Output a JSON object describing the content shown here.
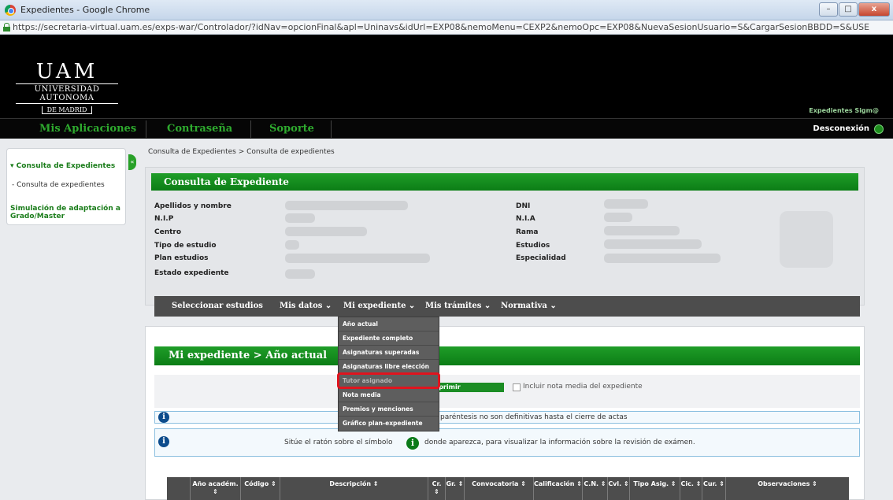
{
  "browser": {
    "window_title": "Expedientes - Google Chrome",
    "url": "https://secretaria-virtual.uam.es/exps-war/Controlador/?idNav=opcionFinal&apl=Uninavs&idUrl=EXP08&nemoMenu=CEXP2&nemoOpc=EXP08&NuevaSesionUsuario=S&CargarSesionBBDD=S&USE",
    "buttons": {
      "minimize": "–",
      "maximize": "□",
      "close": "x"
    }
  },
  "header": {
    "logo_main": "UAM",
    "logo_line1": "UNIVERSIDAD AUTONOMA",
    "logo_line2": "DE MADRID",
    "app_name": "Expedientes Sigm@"
  },
  "topnav": {
    "items": [
      "Mis Aplicaciones",
      "Contraseña",
      "Soporte"
    ],
    "logout": "Desconexión"
  },
  "sidebar": {
    "heading": "▾ Consulta de Expedientes",
    "sub_item": "- Consulta de expedientes",
    "simulation": "Simulación de adaptación a Grado/Master",
    "collapse": "«"
  },
  "breadcrumb": "Consulta de Expedientes > Consulta de expedientes",
  "expediente_panel": {
    "title": "Consulta de Expediente",
    "left_fields": [
      "Apellidos y nombre",
      "N.I.P",
      "Centro",
      "Tipo de estudio",
      "Plan estudios",
      "Estado expediente"
    ],
    "right_fields": [
      "DNI",
      "N.I.A",
      "Rama",
      "Estudios",
      "Especialidad"
    ]
  },
  "menu": {
    "items": [
      "Seleccionar estudios",
      "Mis datos ⌄",
      "Mi expediente ⌄",
      "Mis trámites ⌄",
      "Normativa ⌄"
    ]
  },
  "dropdown": {
    "items": [
      "Año actual",
      "Expediente completo",
      "Asignaturas superadas",
      "Asignaturas libre elección",
      "Tutor asignado",
      "Nota media",
      "Premios y menciones",
      "Gráfico plan-expediente"
    ],
    "highlighted_index": 4
  },
  "year_panel": {
    "title": "Mi expediente > Año actual",
    "print_label": "ra imprimir",
    "checkbox_label": "Incluir nota media del expediente",
    "note1": "paréntesis no son definitivas hasta el cierre de actas",
    "note2_before": "Sitúe el ratón sobre el símbolo",
    "note2_after": "donde aparezca, para visualizar la información sobre la revisión de exámen.",
    "info_glyph": "i"
  },
  "table": {
    "columns": [
      "",
      "Año académ. ⇕",
      "Código ⇕",
      "Descripción ⇕",
      "Cr. ⇕",
      "Gr. ⇕",
      "Convocatoria ⇕",
      "Calificación ⇕",
      "C.N. ⇕",
      "Cvl. ⇕",
      "Tipo Asig. ⇕",
      "Cic. ⇕",
      "Cur. ⇕",
      "Observaciones ⇕"
    ]
  },
  "colors": {
    "green": "#1f9d28",
    "dark_bar": "#4d4d4d",
    "highlight": "#e0141e"
  }
}
